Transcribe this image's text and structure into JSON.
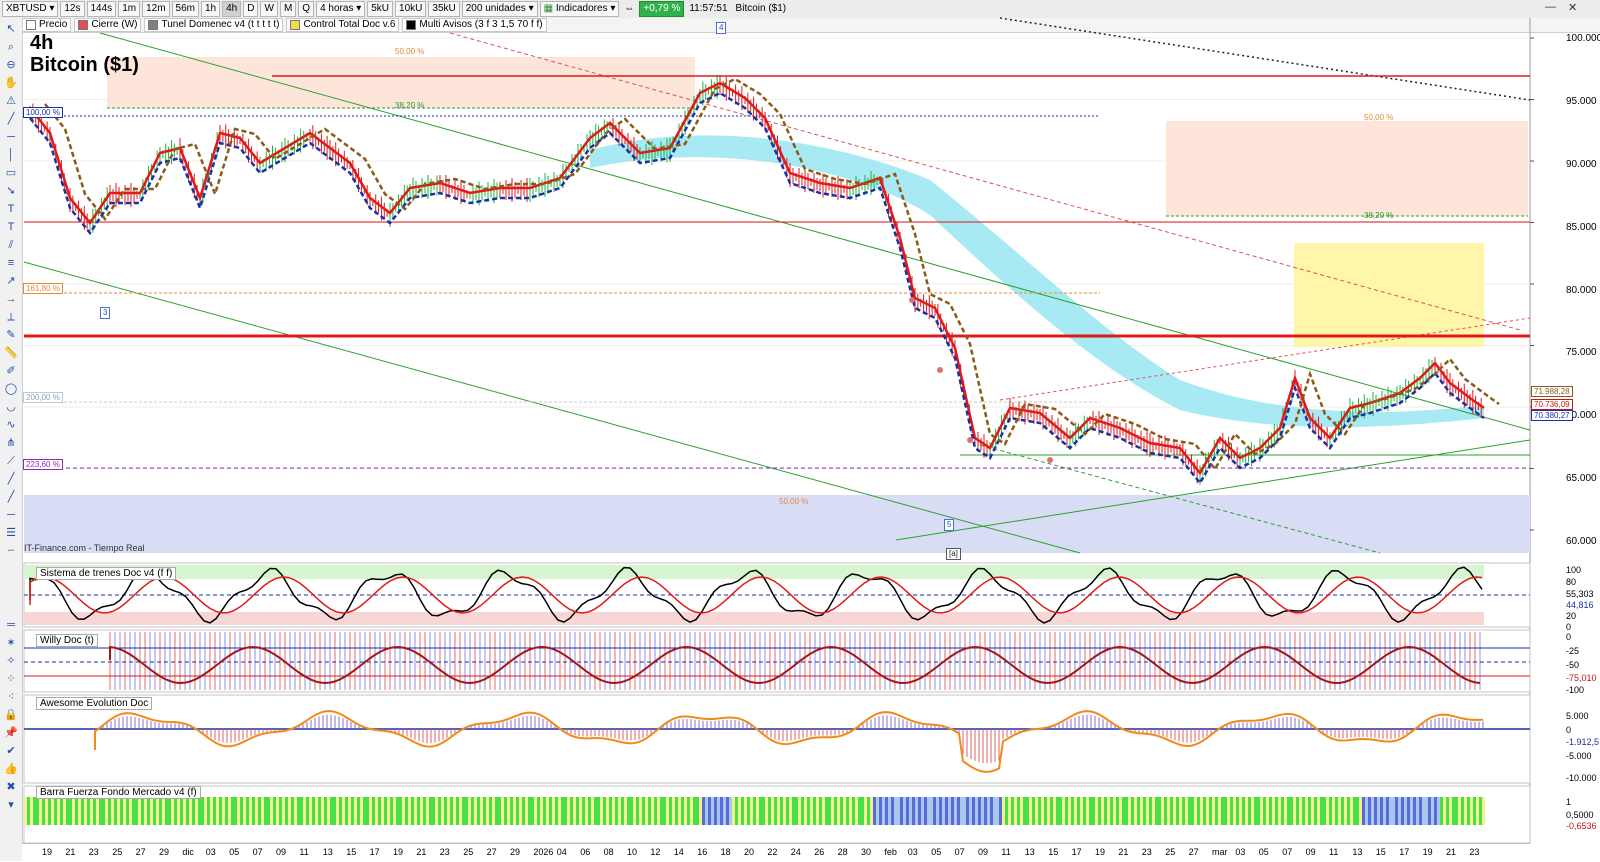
{
  "toolbar": {
    "symbol": "XBTUSD",
    "timeframes": [
      "12s",
      "144s",
      "1m",
      "12m",
      "56m",
      "1h",
      "4h",
      "D",
      "W",
      "M",
      "Q"
    ],
    "active_timeframe": "4h",
    "interval": "4 horas",
    "volumes": [
      "5kU",
      "10kU",
      "35kU"
    ],
    "units": "200 unidades",
    "indicators": "Indicadores",
    "change": "+0,79 %",
    "time": "11:57:51",
    "instrument": "Bitcoin ($1)"
  },
  "tabs": [
    {
      "label": "Precio",
      "color": "#ffffff"
    },
    {
      "label": "Cierre (W)",
      "color": "#e05050"
    },
    {
      "label": "Tunel Domenec v4 (t t t t t)",
      "color": "#808080"
    },
    {
      "label": "Control Total Doc v.6",
      "color": "#f2d94e"
    },
    {
      "label": "Multi Avisos (3 f 3 1,5 70 f f)",
      "color": "#000000"
    }
  ],
  "chart": {
    "timeframe_title": "4h",
    "name_title": "Bitcoin ($1)",
    "credit": "IT-Finance.com - Tiempo Real",
    "price_axis": [
      "100.000",
      "95.000",
      "90.000",
      "85.000",
      "80.000",
      "75.000",
      "70.000",
      "65.000",
      "60.000"
    ],
    "fib_labels": {
      "top_50": "50,00 %",
      "top_382": "38,20 %",
      "p100": "100,00 %",
      "p1618": "161,80 %",
      "p200": "200,00 %",
      "p2236": "223,60 %",
      "bottom_50": "50,00 %",
      "right_50": "50,00 %",
      "right_382": "38,20 %"
    },
    "wave_labels": [
      "3",
      "4",
      "5",
      "[a]"
    ],
    "price_tags": [
      "71.988,28",
      "70.736,09",
      "70.380,27"
    ],
    "colors": {
      "up": "#19b43a",
      "down": "#e01a1a",
      "ema_fast": "#e01a1a",
      "ema_slow": "#1a2fa8",
      "ema_brown": "#8a5a17",
      "cloud": "#8be3f0",
      "channel": "#2ca12c"
    }
  },
  "panels": [
    {
      "title": "Sistema de trenes Doc v4 (f f)",
      "axis": [
        "100",
        "80",
        "55,303",
        "44,816",
        "20",
        "0"
      ]
    },
    {
      "title": "Willy Doc (t)",
      "axis": [
        "0",
        "-25",
        "-50",
        "-75,010",
        "-100"
      ]
    },
    {
      "title": "Awesome Evolution Doc",
      "axis": [
        "5.000",
        "0",
        "-1.912,5",
        "-5.000",
        "-10.000"
      ]
    },
    {
      "title": "Barra Fuerza Fondo Mercado v4 (f)",
      "axis": [
        "1",
        "0,5000",
        "-0,6536"
      ]
    }
  ],
  "dates": [
    "19",
    "21",
    "23",
    "25",
    "27",
    "29",
    "dic",
    "03",
    "05",
    "07",
    "09",
    "11",
    "13",
    "15",
    "17",
    "19",
    "21",
    "23",
    "25",
    "27",
    "29",
    "2026",
    "04",
    "06",
    "08",
    "10",
    "12",
    "14",
    "16",
    "18",
    "20",
    "22",
    "24",
    "26",
    "28",
    "30",
    "feb",
    "03",
    "05",
    "07",
    "09",
    "11",
    "13",
    "15",
    "17",
    "19",
    "21",
    "23",
    "25",
    "27",
    "mar",
    "03",
    "05",
    "07",
    "09",
    "11",
    "13",
    "15",
    "17",
    "19",
    "21",
    "23"
  ]
}
